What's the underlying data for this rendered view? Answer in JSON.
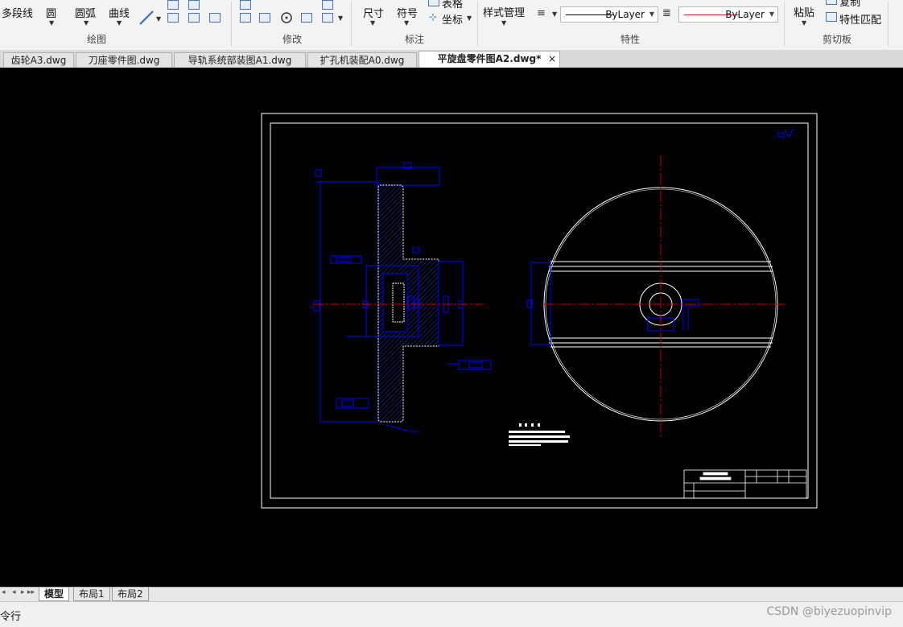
{
  "ribbon": {
    "draw": {
      "polyline": "多段线",
      "circle": "圆",
      "arc": "圆弧",
      "curve": "曲线",
      "label": "绘图"
    },
    "modify": {
      "label": "修改"
    },
    "annotate": {
      "dimension": "尺寸",
      "symbol": "符号",
      "table": "表格",
      "coordinate": "坐标",
      "label": "标注"
    },
    "properties": {
      "style_manager": "样式管理",
      "linetype": "ByLayer",
      "color": "ByLayer",
      "label": "特性",
      "line_colors": {
        "linetype": "#000000",
        "color": "#e02020"
      }
    },
    "clipboard": {
      "paste": "粘贴",
      "copy": "复制",
      "match": "特性匹配",
      "label": "剪切板"
    }
  },
  "tabs": [
    {
      "label": "齿轮A3.dwg"
    },
    {
      "label": "刀座零件图.dwg"
    },
    {
      "label": "导轨系统部装图A1.dwg"
    },
    {
      "label": "扩孔机装配A0.dwg"
    },
    {
      "label": "平旋盘零件图A2.dwg*"
    }
  ],
  "active_tab_index": 4,
  "tab_close_glyph": "×",
  "layout_tabs": [
    {
      "label": "模型"
    },
    {
      "label": "布局1"
    },
    {
      "label": "布局2"
    }
  ],
  "nav_glyphs": [
    "◂",
    "◂",
    "▸",
    "▸▸"
  ],
  "command": {
    "label": "令行"
  },
  "watermark": "CSDN @biyezuopinvip",
  "colors": {
    "drawing_blue": "#0000ff",
    "drawing_white": "#ffffff",
    "centerline_red": "#d00000",
    "hatch": "#3333cc"
  }
}
